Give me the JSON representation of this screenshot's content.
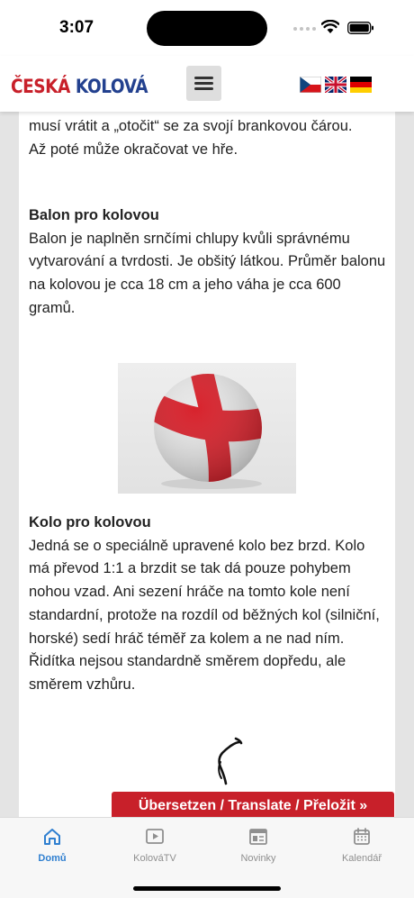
{
  "status": {
    "time": "3:07"
  },
  "header": {
    "logo_part1": "ČESKÁ",
    "logo_part2": "KOLOVÁ",
    "flags": [
      "cz-flag-icon",
      "uk-flag-icon",
      "de-flag-icon"
    ]
  },
  "article": {
    "intro_line1": "musí vrátit a „otočit“ se za svojí brankovou čárou.",
    "intro_line2": "Až poté může  okračovat ve hře.",
    "ball_heading": "Balon pro kolovou",
    "ball_text": "Balon je naplněn srnčími chlupy kvůli správnému vytvarování a tvrdosti. Je obšitý látkou. Průměr balonu na kolovou je cca 18 cm a jeho váha je cca 600 gramů.",
    "bike_heading": "Kolo pro kolovou",
    "bike_text": "Jedná se o speciálně upravené kolo bez brzd. Kolo má převod 1:1 a brzdit se tak dá pouze pohybem nohou vzad. Ani sezení hráče na tomto kole není standardní, protože na rozdíl od běžných kol (silniční, horské) sedí hráč téměř za kolem a ne nad ním. Řidítka nejsou standardně směrem dopředu, ale směrem vzhůru."
  },
  "translate_label": "Übersetzen / Translate / Přeložit »",
  "tabs": [
    {
      "label": "Domů",
      "icon": "home-icon",
      "active": true
    },
    {
      "label": "KolováTV",
      "icon": "play-icon",
      "active": false
    },
    {
      "label": "Novinky",
      "icon": "news-icon",
      "active": false
    },
    {
      "label": "Kalendář",
      "icon": "calendar-icon",
      "active": false
    }
  ],
  "colors": {
    "brand_red": "#c8202a",
    "brand_blue": "#23418f",
    "tab_active": "#2f7fd0",
    "tab_inactive": "#8f8f8f"
  }
}
